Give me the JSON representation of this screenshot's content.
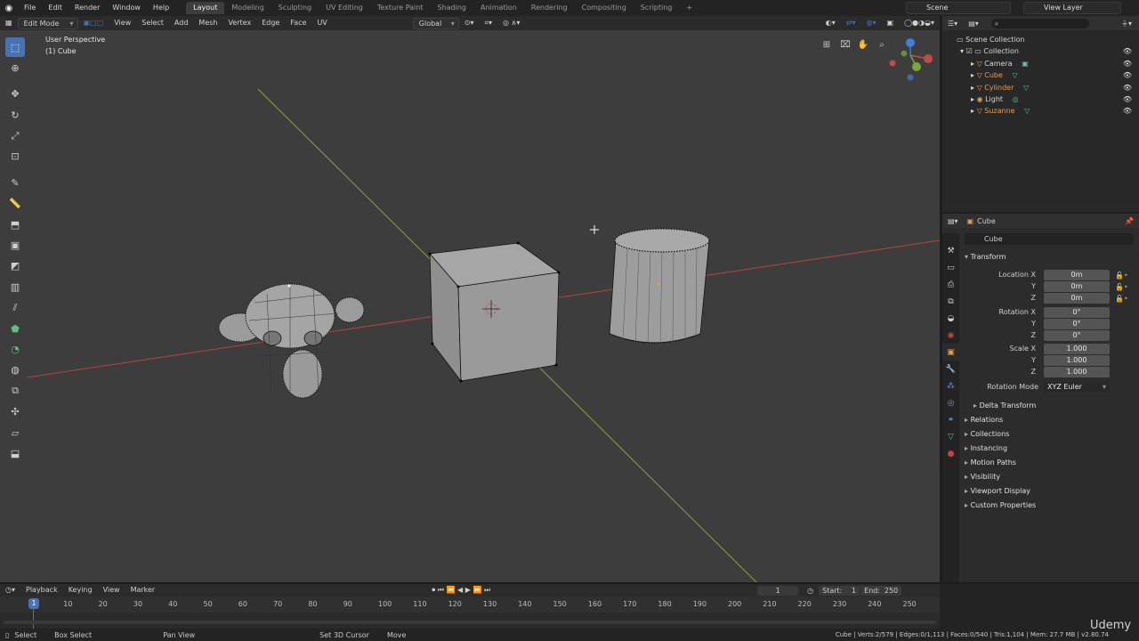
{
  "topbar": {
    "menus": [
      "File",
      "Edit",
      "Render",
      "Window",
      "Help"
    ],
    "workspaces": [
      "Layout",
      "Modeling",
      "Sculpting",
      "UV Editing",
      "Texture Paint",
      "Shading",
      "Animation",
      "Rendering",
      "Compositing",
      "Scripting"
    ],
    "active_workspace": "Layout",
    "add_tab": "+",
    "scene": "Scene",
    "view_layer": "View Layer"
  },
  "viewport_header": {
    "mode": "Edit Mode",
    "menus": [
      "View",
      "Select",
      "Add",
      "Mesh",
      "Vertex",
      "Edge",
      "Face",
      "UV"
    ],
    "orientation": "Global"
  },
  "viewport": {
    "perspective_label": "User Perspective",
    "object_label": "(1) Cube"
  },
  "outliner": {
    "root": "Scene Collection",
    "collection": "Collection",
    "items": [
      {
        "name": "Camera",
        "selected": false
      },
      {
        "name": "Cube",
        "selected": true
      },
      {
        "name": "Cylinder",
        "selected": true
      },
      {
        "name": "Light",
        "selected": false
      },
      {
        "name": "Suzanne",
        "selected": true
      }
    ]
  },
  "properties": {
    "context_object": "Cube",
    "object_name": "Cube",
    "transform_label": "Transform",
    "location_label": "Location X",
    "rotation_label": "Rotation X",
    "scale_label": "Scale X",
    "y_label": "Y",
    "z_label": "Z",
    "location": [
      "0m",
      "0m",
      "0m"
    ],
    "rotation": [
      "0°",
      "0°",
      "0°"
    ],
    "scale": [
      "1.000",
      "1.000",
      "1.000"
    ],
    "rotation_mode_label": "Rotation Mode",
    "rotation_mode": "XYZ Euler",
    "delta_transform": "Delta Transform",
    "panels": [
      "Relations",
      "Collections",
      "Instancing",
      "Motion Paths",
      "Visibility",
      "Viewport Display",
      "Custom Properties"
    ]
  },
  "timeline": {
    "menus": [
      "Playback",
      "Keying",
      "View",
      "Marker"
    ],
    "current_frame": "1",
    "start_label": "Start:",
    "start": "1",
    "end_label": "End:",
    "end": "250",
    "ticks": [
      "10",
      "20",
      "30",
      "40",
      "50",
      "60",
      "70",
      "80",
      "90",
      "100",
      "110",
      "120",
      "130",
      "140",
      "150",
      "160",
      "170",
      "180",
      "190",
      "200",
      "210",
      "220",
      "230",
      "240",
      "250"
    ]
  },
  "statusbar": {
    "items": [
      "Select",
      "Box Select",
      "Pan View",
      "Set 3D Cursor",
      "Move"
    ],
    "stats": "Cube | Verts:2/579 | Edges:0/1,113 | Faces:0/540 | Tris:1,104 | Mem: 27.7 MB | v2.80.74"
  },
  "watermark": "Udemy",
  "colors": {
    "accent": "#4772b3",
    "selected_orange": "#e89e4a",
    "x_axis": "#b5433f",
    "y_axis": "#8ea13a",
    "viewport_bg": "#3d3d3d"
  }
}
